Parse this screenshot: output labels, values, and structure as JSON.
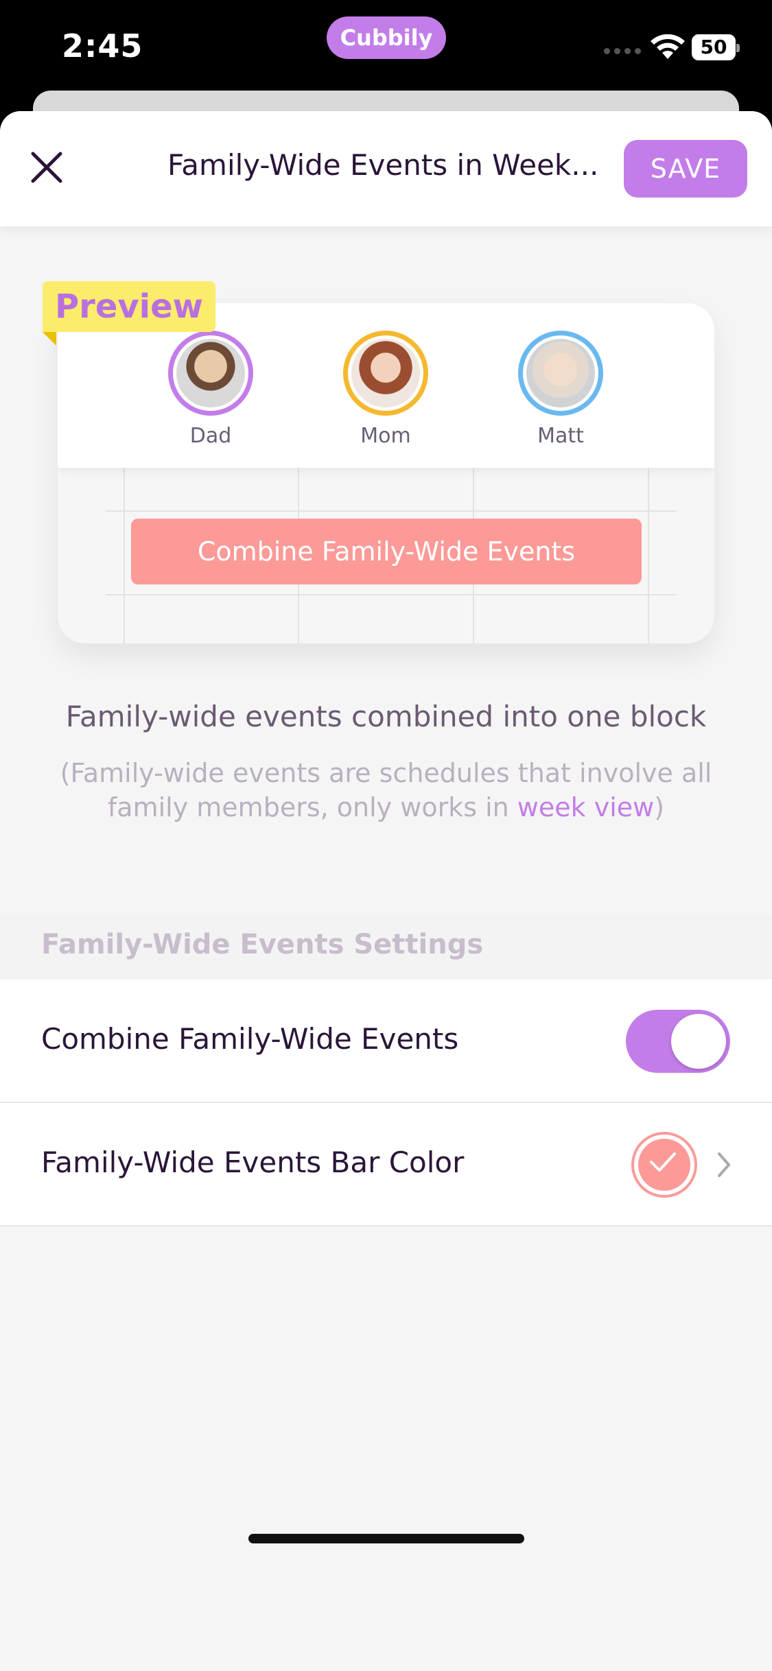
{
  "status_bar": {
    "time": "2:45",
    "app_pill": "Cubbily",
    "battery": "50"
  },
  "nav": {
    "title": "Family-Wide Events in Week...",
    "save_label": "SAVE",
    "close_icon": "close-icon"
  },
  "preview": {
    "tag": "Preview",
    "members": [
      {
        "name": "Dad",
        "ring_color": "#c37de8"
      },
      {
        "name": "Mom",
        "ring_color": "#f5b82e"
      },
      {
        "name": "Matt",
        "ring_color": "#6ab8f0"
      }
    ],
    "combined_bar_label": "Combine Family-Wide Events",
    "combined_bar_color": "#fc9a98"
  },
  "description": {
    "main": "Family-wide events combined into one block",
    "sub_prefix": "(Family-wide events are schedules that involve all family members, only works in ",
    "sub_link": "week view",
    "sub_suffix": ")"
  },
  "settings": {
    "section_title": "Family-Wide Events Settings",
    "combine_label": "Combine Family-Wide Events",
    "combine_enabled": true,
    "bar_color_label": "Family-Wide Events Bar Color",
    "bar_color": "#fc9a98"
  },
  "colors": {
    "accent": "#c37de8",
    "title_text": "#2a1538"
  }
}
